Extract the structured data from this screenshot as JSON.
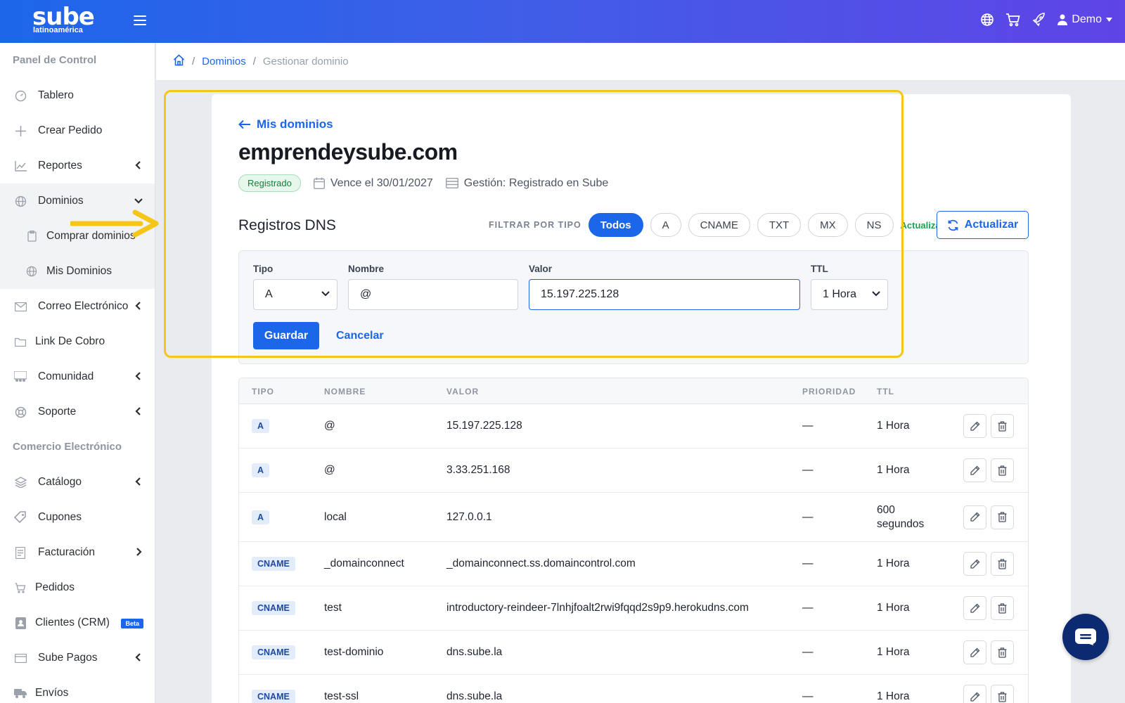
{
  "app": {
    "logo_main": "sube",
    "logo_sub": "latinoamérica",
    "user_name": "Demo"
  },
  "colors": {
    "primary": "#1c66ea",
    "topbar_start": "#1c66ea",
    "topbar_end": "#5f44e6",
    "highlight": "#f5c518",
    "success": "#16a34a"
  },
  "sidebar": {
    "section1": "Panel de Control",
    "items": [
      {
        "label": "Tablero",
        "icon": "gauge-icon"
      },
      {
        "label": "Crear Pedido",
        "icon": "plus-icon"
      },
      {
        "label": "Reportes",
        "icon": "chart-line-icon"
      },
      {
        "label": "Dominios",
        "icon": "globe-icon"
      },
      {
        "label": "Comprar dominios",
        "icon": "clipboard-icon"
      },
      {
        "label": "Mis Dominios",
        "icon": "globe-icon"
      },
      {
        "label": "Correo Electrónico",
        "icon": "envelope-icon"
      },
      {
        "label": "Link De Cobro",
        "icon": "folder-icon"
      },
      {
        "label": "Comunidad",
        "icon": "users-icon"
      },
      {
        "label": "Soporte",
        "icon": "lifebuoy-icon"
      }
    ],
    "section2": "Comercio Electrónico",
    "items2": [
      {
        "label": "Catálogo",
        "icon": "layers-icon"
      },
      {
        "label": "Cupones",
        "icon": "tag-icon"
      },
      {
        "label": "Facturación",
        "icon": "invoice-icon"
      },
      {
        "label": "Pedidos",
        "icon": "cart-icon"
      },
      {
        "label": "Clientes (CRM)",
        "icon": "contact-icon",
        "badge": "Beta"
      },
      {
        "label": "Sube Pagos",
        "icon": "credit-card-icon"
      },
      {
        "label": "Envíos",
        "icon": "truck-icon"
      }
    ]
  },
  "breadcrumb": {
    "link": "Dominios",
    "current": "Gestionar dominio"
  },
  "domain": {
    "back_label": "Mis dominios",
    "name": "emprendeysube.com",
    "status": "Registrado",
    "expires": "Vence el 30/01/2027",
    "management": "Gestión: Registrado en Sube"
  },
  "dns": {
    "title": "Registros DNS",
    "filter_label": "FILTRAR POR TIPO",
    "filters": [
      "Todos",
      "A",
      "CNAME",
      "TXT",
      "MX",
      "NS"
    ],
    "active_filter": "Todos",
    "updated_label": "Actualizado",
    "refresh_label": "Actualizar"
  },
  "form": {
    "type_label": "Tipo",
    "type_value": "A",
    "name_label": "Nombre",
    "name_value": "@",
    "value_label": "Valor",
    "value_value": "15.197.225.128",
    "ttl_label": "TTL",
    "ttl_value": "1 Hora",
    "save_label": "Guardar",
    "cancel_label": "Cancelar"
  },
  "table": {
    "headers": [
      "TIPO",
      "NOMBRE",
      "VALOR",
      "PRIORIDAD",
      "TTL"
    ],
    "rows": [
      {
        "type": "A",
        "name": "@",
        "value": "15.197.225.128",
        "priority": "—",
        "ttl": "1 Hora"
      },
      {
        "type": "A",
        "name": "@",
        "value": "3.33.251.168",
        "priority": "—",
        "ttl": "1 Hora"
      },
      {
        "type": "A",
        "name": "local",
        "value": "127.0.0.1",
        "priority": "—",
        "ttl": "600 segundos"
      },
      {
        "type": "CNAME",
        "name": "_domainconnect",
        "value": "_domainconnect.ss.domaincontrol.com",
        "priority": "—",
        "ttl": "1 Hora"
      },
      {
        "type": "CNAME",
        "name": "test",
        "value": "introductory-reindeer-7lnhjfoalt2rwi9fqqd2s9p9.herokudns.com",
        "priority": "—",
        "ttl": "1 Hora"
      },
      {
        "type": "CNAME",
        "name": "test-dominio",
        "value": "dns.sube.la",
        "priority": "—",
        "ttl": "1 Hora"
      },
      {
        "type": "CNAME",
        "name": "test-ssl",
        "value": "dns.sube.la",
        "priority": "—",
        "ttl": "1 Hora"
      }
    ]
  }
}
